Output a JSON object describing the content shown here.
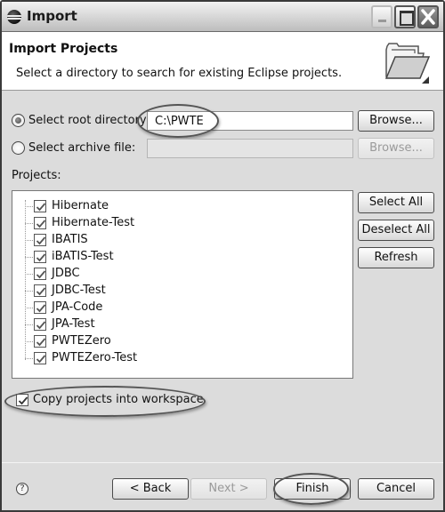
{
  "window": {
    "title": "Import",
    "icons": {
      "app": "eclipse-icon",
      "minimize": "minimize-icon",
      "maximize": "maximize-icon",
      "close": "close-icon"
    }
  },
  "banner": {
    "title": "Import Projects",
    "description": "Select a directory to search for existing Eclipse projects.",
    "icon": "folder-open-icon"
  },
  "source": {
    "root_directory": {
      "label": "Select root directory:",
      "selected": true,
      "value": "C:\\PWTE",
      "browse_label": "Browse..."
    },
    "archive_file": {
      "label": "Select archive file:",
      "selected": false,
      "value": "",
      "browse_label": "Browse...",
      "enabled": false
    }
  },
  "projects": {
    "label": "Projects:",
    "items": [
      {
        "name": "Hibernate",
        "checked": true
      },
      {
        "name": "Hibernate-Test",
        "checked": true
      },
      {
        "name": "IBATIS",
        "checked": true
      },
      {
        "name": "iBATIS-Test",
        "checked": true
      },
      {
        "name": "JDBC",
        "checked": true
      },
      {
        "name": "JDBC-Test",
        "checked": true
      },
      {
        "name": "JPA-Code",
        "checked": true
      },
      {
        "name": "JPA-Test",
        "checked": true
      },
      {
        "name": "PWTEZero",
        "checked": true
      },
      {
        "name": "PWTEZero-Test",
        "checked": true
      }
    ],
    "buttons": {
      "select_all": "Select All",
      "deselect_all": "Deselect All",
      "refresh": "Refresh"
    }
  },
  "options": {
    "copy_into_workspace": {
      "label": "Copy projects into workspace",
      "checked": true
    }
  },
  "footer": {
    "help_icon": "?",
    "back": "< Back",
    "next": "Next >",
    "finish": "Finish",
    "cancel": "Cancel"
  }
}
